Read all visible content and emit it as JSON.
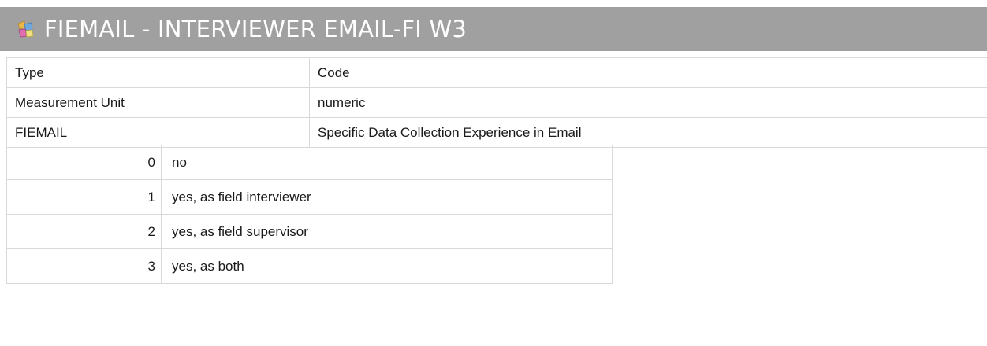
{
  "header": {
    "icon": "variable-icon",
    "title": "FIEMAIL - INTERVIEWER EMAIL-FI W3"
  },
  "properties": [
    {
      "key": "Type",
      "value": "Code"
    },
    {
      "key": "Measurement Unit",
      "value": "numeric"
    },
    {
      "key": "FIEMAIL",
      "value": "Specific Data Collection Experience in Email"
    }
  ],
  "codes": [
    {
      "value": "0",
      "label": "no"
    },
    {
      "value": "1",
      "label": "yes, as field interviewer"
    },
    {
      "value": "2",
      "label": "yes, as field supervisor"
    },
    {
      "value": "3",
      "label": "yes, as both"
    }
  ],
  "colors": {
    "titlebar": "#a0a0a0",
    "title_text": "#ffffff",
    "grid": "#d9d9d9"
  }
}
